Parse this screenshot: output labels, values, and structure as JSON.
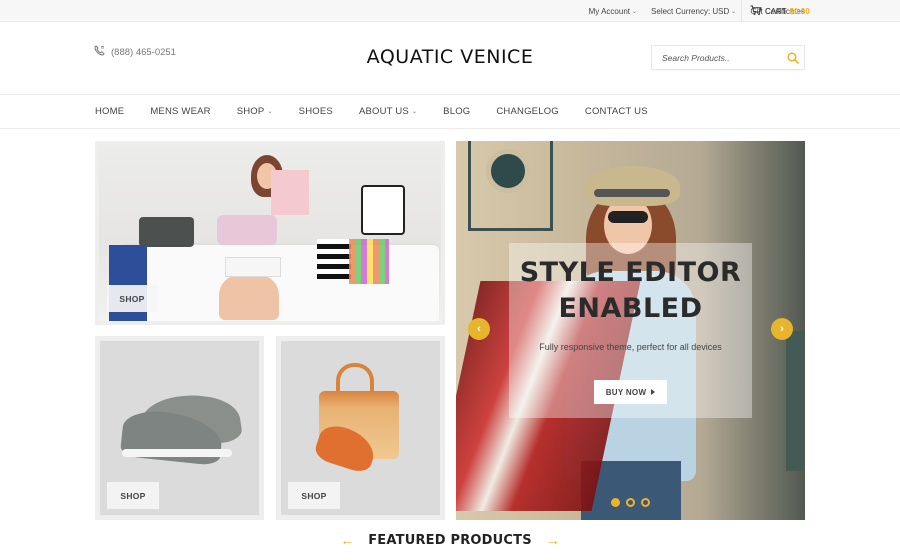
{
  "topbar": {
    "my_account": "My Account",
    "currency": "Select Currency: USD",
    "gift": "Gift Certificates",
    "cart_label": "CART",
    "cart_amount": "$0.00",
    "accent_color": "#f0b323"
  },
  "header": {
    "phone": "(888) 465-0251",
    "logo": "AQUATIC VENICE",
    "search_placeholder": "Search Products.."
  },
  "nav": {
    "items": [
      {
        "label": "HOME",
        "dropdown": false
      },
      {
        "label": "MENS WEAR",
        "dropdown": false
      },
      {
        "label": "SHOP",
        "dropdown": true
      },
      {
        "label": "SHOES",
        "dropdown": false
      },
      {
        "label": "ABOUT US",
        "dropdown": true
      },
      {
        "label": "BLOG",
        "dropdown": false
      },
      {
        "label": "CHANGELOG",
        "dropdown": false
      },
      {
        "label": "CONTACT US",
        "dropdown": false
      }
    ]
  },
  "banners": {
    "main_shop": "SHOP",
    "shoes_shop": "SHOP",
    "bag_shop": "SHOP"
  },
  "hero": {
    "title_line1": "STYLE EDITOR",
    "title_line2": "ENABLED",
    "subtitle": "Fully responsive theme, perfect for all devices",
    "button": "BUY NOW",
    "slides_total": 3,
    "active_slide": 1
  },
  "featured": {
    "title": "FEATURED PRODUCTS"
  }
}
